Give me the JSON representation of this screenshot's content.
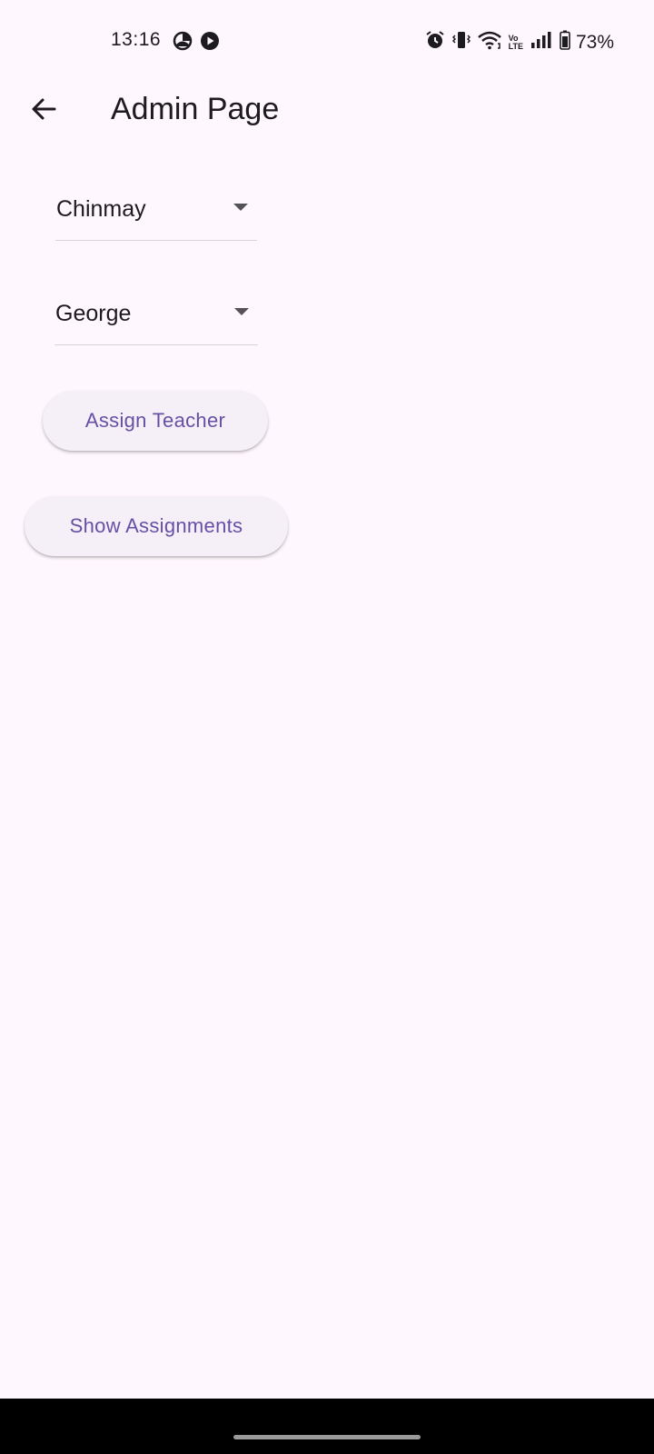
{
  "status_bar": {
    "time": "13:16",
    "battery": "73%",
    "left_icons": [
      "data-saver-icon",
      "play-circle-icon"
    ],
    "right_icons": [
      "alarm-icon",
      "vibrate-icon",
      "wifi-icon",
      "volte-icon",
      "signal-icon",
      "battery-icon"
    ],
    "volte_top": "Vo",
    "volte_bottom": "LTE"
  },
  "app_bar": {
    "title": "Admin Page",
    "back_icon": "arrow-left-icon"
  },
  "form": {
    "student_dropdown": {
      "value": "Chinmay"
    },
    "teacher_dropdown": {
      "value": "George"
    },
    "assign_button": "Assign Teacher",
    "show_button": "Show Assignments"
  },
  "colors": {
    "background": "#fef7fd",
    "accent": "#6750a4",
    "button_surface": "#f5eff7",
    "text": "#1d1b20"
  }
}
